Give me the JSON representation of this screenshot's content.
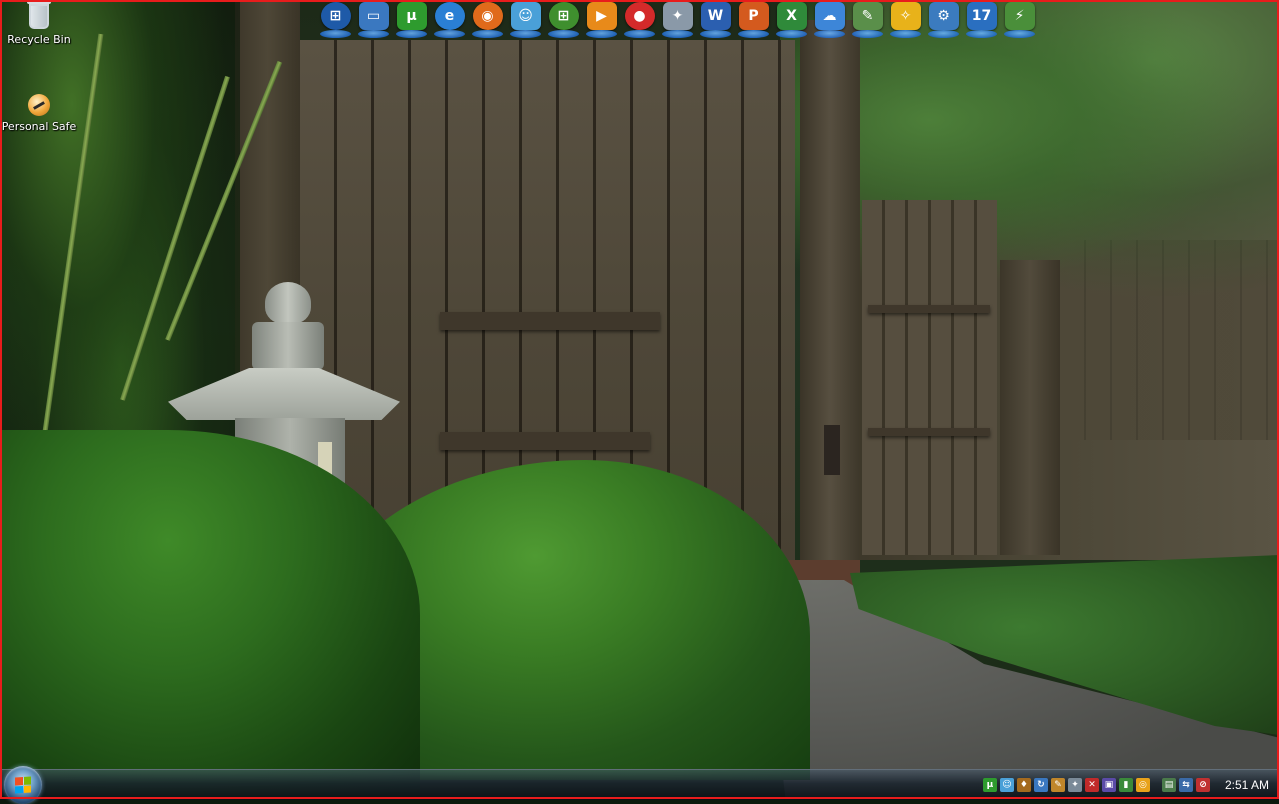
{
  "desktop": {
    "icons": [
      {
        "label": "Recycle Bin",
        "icon": "recycle-bin-icon"
      },
      {
        "label": "Personal Safe",
        "icon": "personal-safe-icon"
      }
    ]
  },
  "dock": {
    "items": [
      {
        "name": "windows-start-icon",
        "glyph": "⊞",
        "color": "#1e5aa8"
      },
      {
        "name": "remote-desktop-icon",
        "glyph": "▭",
        "color": "#3a78c0"
      },
      {
        "name": "utorrent-icon",
        "glyph": "µ",
        "color": "#2e9b2e"
      },
      {
        "name": "internet-explorer-icon",
        "glyph": "e",
        "color": "#2a7fd4"
      },
      {
        "name": "firefox-icon",
        "glyph": "◉",
        "color": "#e06a1b"
      },
      {
        "name": "messenger-icon",
        "glyph": "☺",
        "color": "#4aa0d8"
      },
      {
        "name": "windows-update-icon",
        "glyph": "⊞",
        "color": "#3f8f2e"
      },
      {
        "name": "media-player-icon",
        "glyph": "▶",
        "color": "#e88a1a"
      },
      {
        "name": "burner-icon",
        "glyph": "●",
        "color": "#d42a2a"
      },
      {
        "name": "cleaner-icon",
        "glyph": "✦",
        "color": "#8a99a8"
      },
      {
        "name": "word-icon",
        "glyph": "W",
        "color": "#2b5fb0"
      },
      {
        "name": "powerpoint-icon",
        "glyph": "P",
        "color": "#d45a1e"
      },
      {
        "name": "excel-icon",
        "glyph": "X",
        "color": "#2f8a3a"
      },
      {
        "name": "weather-icon",
        "glyph": "☁",
        "color": "#3d86d8"
      },
      {
        "name": "notes-icon",
        "glyph": "✎",
        "color": "#5a8f4a"
      },
      {
        "name": "tools-icon",
        "glyph": "✧",
        "color": "#e8b21a"
      },
      {
        "name": "settings-icon",
        "glyph": "⚙",
        "color": "#3b7bbf"
      },
      {
        "name": "calendar-icon",
        "glyph": "17",
        "color": "#2a6fc0"
      },
      {
        "name": "network-icon",
        "glyph": "⚡",
        "color": "#4a8f3a"
      }
    ]
  },
  "taskbar": {
    "start": "start-button",
    "tray_icons": [
      {
        "name": "utorrent-tray-icon",
        "glyph": "µ",
        "color": "#2e9b2e"
      },
      {
        "name": "messenger-tray-icon",
        "glyph": "☺",
        "color": "#4aa0d8"
      },
      {
        "name": "security-tray-icon",
        "glyph": "♦",
        "color": "#a46a1e"
      },
      {
        "name": "update-tray-icon",
        "glyph": "↻",
        "color": "#3a78c0"
      },
      {
        "name": "edit-tray-icon",
        "glyph": "✎",
        "color": "#c0862a"
      },
      {
        "name": "cleaner-tray-icon",
        "glyph": "✦",
        "color": "#7a8a98"
      },
      {
        "name": "close-tray-icon",
        "glyph": "✕",
        "color": "#c02a2a"
      },
      {
        "name": "program-tray-icon",
        "glyph": "▣",
        "color": "#5a4aa8"
      },
      {
        "name": "battery-tray-icon",
        "glyph": "▮",
        "color": "#3a8a3a"
      },
      {
        "name": "avast-tray-icon",
        "glyph": "◎",
        "color": "#e8a21a"
      },
      {
        "name": "safely-remove-tray-icon",
        "glyph": "▤",
        "color": "#4a7a4a"
      },
      {
        "name": "network-tray-icon",
        "glyph": "⇆",
        "color": "#3a6aa8"
      },
      {
        "name": "volume-muted-tray-icon",
        "glyph": "⊘",
        "color": "#c03030"
      }
    ],
    "clock": "2:51 AM"
  }
}
